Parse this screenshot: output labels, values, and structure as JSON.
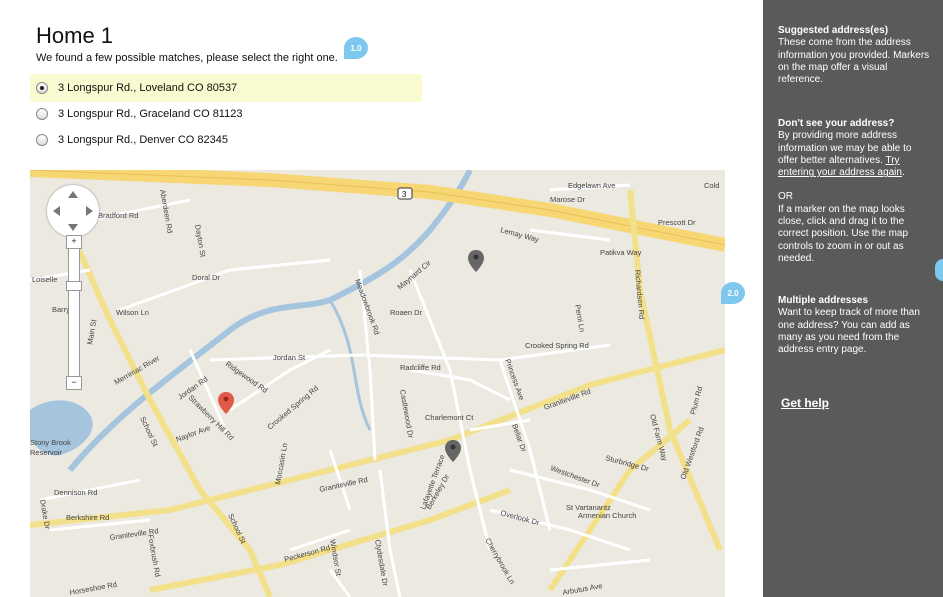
{
  "title": "Home 1",
  "subtitle": "We found a few possible matches, please select the right one.",
  "annotations": {
    "a1": "1.0",
    "a2": "2.0"
  },
  "options": [
    {
      "label": "3 Longspur Rd., Loveland CO 80537",
      "selected": true
    },
    {
      "label": "3 Longspur Rd., Graceland CO 81123",
      "selected": false
    },
    {
      "label": "3 Longspur Rd., Denver CO 82345",
      "selected": false
    }
  ],
  "map": {
    "streets": [
      "Edgelawn Ave",
      "Marose Dr",
      "Bradford Rd",
      "Aberdeen Rd",
      "Dayton St",
      "Lemay Way",
      "Prescott Dr",
      "Patikva Way",
      "Loiselle",
      "Doral Dr",
      "Meadowbrook Rd",
      "Maynard Cir",
      "Barry Dr",
      "Wilson Ln",
      "Roaen Dr",
      "Richardson Rd",
      "Perni Ln",
      "Merrimac River",
      "Crooked Spring Rd",
      "Jordan St",
      "Radcliffe Rd",
      "Main St",
      "Ridgewood Rd",
      "Jordan Rd",
      "Strawberry Hill Rd",
      "Princess Ave",
      "Graniteville Rd",
      "School St",
      "Naylor Ave",
      "Castlewood Dr",
      "Charlemont Ct",
      "Beliar Dr",
      "Old Farm Way",
      "Plum Rd",
      "Old Westford Rd",
      "Moccasin Ln",
      "Westchester Dr",
      "Sturbridge Dr",
      "Stony Brook Reservoir",
      "Dennison Rd",
      "Lafayette Terrace",
      "Berkeley Dr",
      "St Vartanantz Armenian Church",
      "Drake Dr",
      "Berkshire Rd",
      "Overlook Dr",
      "Cherrybrook Ln",
      "Foxbrush Rd",
      "Peckerson Rd",
      "Windsor St",
      "Clydesdale Dr",
      "Arbutus Ave",
      "Horseshoe Rd",
      "Cold",
      "Graniteville Rd"
    ],
    "route": "3"
  },
  "sidebar": {
    "h1": "Suggested address(es)",
    "p1": "These come from the address information you provided. Markers on the map offer a visual reference.",
    "h2": "Don't see your address?",
    "p2": "By providing more address information we may be able to offer better alternatives.",
    "link": "Try entering your address again",
    "or": "OR",
    "p3": "If a marker on the map looks close, click and drag it to the correct position. Use the map controls to zoom in or out as needed.",
    "h3": "Multiple addresses",
    "p4": "Want to keep track of more than one address? You can add as many as you need from the address entry page.",
    "help": "Get help"
  },
  "colors": {
    "selected_row": "#fafad0",
    "sidebar": "#5a5a5a",
    "annotation": "#7ec8ef",
    "highway": "#f7d774",
    "river": "#9fc1dc"
  }
}
